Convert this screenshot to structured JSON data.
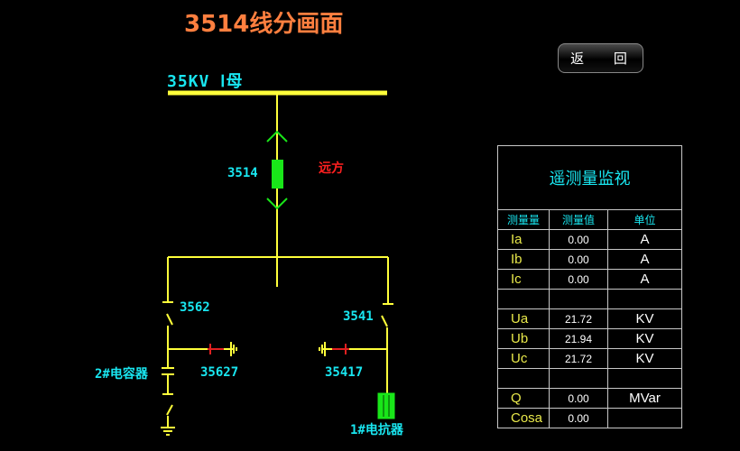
{
  "title": "3514线分画面",
  "back_button": "返 回",
  "bus": {
    "label": "35KV Ⅰ母"
  },
  "breaker": {
    "id": "3514",
    "mode": "远方"
  },
  "left_branch": {
    "switch": "3562",
    "ground_switch": "35627",
    "device": "2#电容器"
  },
  "right_branch": {
    "switch": "3541",
    "ground_switch": "35417",
    "device": "1#电抗器"
  },
  "panel": {
    "title": "遥测量监视",
    "headers": [
      "测量量",
      "测量值",
      "单位"
    ],
    "rows": [
      {
        "name": "Ia",
        "value": "0.00",
        "unit": "A"
      },
      {
        "name": "Ib",
        "value": "0.00",
        "unit": "A"
      },
      {
        "name": "Ic",
        "value": "0.00",
        "unit": "A"
      },
      {
        "name": "",
        "value": "",
        "unit": ""
      },
      {
        "name": "Ua",
        "value": "21.72",
        "unit": "KV"
      },
      {
        "name": "Ub",
        "value": "21.94",
        "unit": "KV"
      },
      {
        "name": "Uc",
        "value": "21.72",
        "unit": "KV"
      },
      {
        "name": "",
        "value": "",
        "unit": ""
      },
      {
        "name": "Q",
        "value": "0.00",
        "unit": "MVar"
      },
      {
        "name": "Cosa",
        "value": "0.00",
        "unit": ""
      }
    ]
  },
  "colors": {
    "line": "#ffff3a",
    "breaker": "#19e619",
    "label": "#19e6f0",
    "ground_switch": "#e02020",
    "title": "#ff7f3f"
  }
}
